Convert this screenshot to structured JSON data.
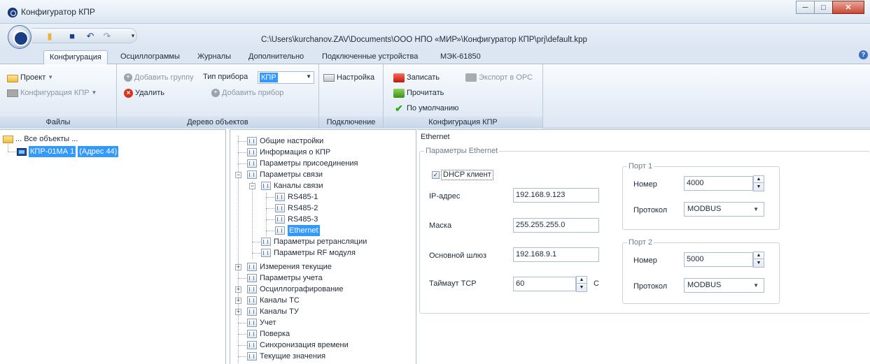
{
  "window": {
    "title": "Конфигуратор КПР",
    "file_path": "C:\\Users\\kurchanov.ZAV\\Documents\\ООО НПО «МИР»\\Конфигуратор КПР\\prj\\default.kpp"
  },
  "tabs": [
    {
      "label": "Конфигурация"
    },
    {
      "label": "Осциллограммы"
    },
    {
      "label": "Журналы"
    },
    {
      "label": "Дополнительно"
    },
    {
      "label": "Подключенные устройства"
    },
    {
      "label": "МЭК-61850"
    }
  ],
  "ribbon": {
    "files": {
      "label": "Файлы",
      "project": "Проект",
      "config": "Конфигурация КПР"
    },
    "tree": {
      "label": "Дерево объектов",
      "add_group": "Добавить группу",
      "device_type_label": "Тип прибора",
      "device_type_value": "КПР",
      "delete": "Удалить",
      "add_device": "Добавить прибор"
    },
    "connection": {
      "label": "Подключение",
      "settings": "Настройка"
    },
    "kpr_config": {
      "label": "Конфигурация КПР",
      "write": "Записать",
      "export_opc": "Экспорт в OPC",
      "read": "Прочитать",
      "defaults": "По умолчанию"
    }
  },
  "objects_tree": {
    "root": "... Все объекты ...",
    "device_name": "КПР-01МА 1",
    "device_address": "(Адрес 44)"
  },
  "settings_tree": [
    {
      "label": "Общие настройки"
    },
    {
      "label": "Информация о КПР"
    },
    {
      "label": "Параметры присоединения"
    },
    {
      "label": "Параметры связи"
    },
    {
      "label": "Каналы связи"
    },
    {
      "label": "RS485-1"
    },
    {
      "label": "RS485-2"
    },
    {
      "label": "RS485-3"
    },
    {
      "label": "Ethernet"
    },
    {
      "label": "Параметры ретрансляции"
    },
    {
      "label": "Параметры RF модуля"
    },
    {
      "label": "Измерения текущие"
    },
    {
      "label": "Параметры учета"
    },
    {
      "label": "Осциллографирование"
    },
    {
      "label": "Каналы ТС"
    },
    {
      "label": "Каналы ТУ"
    },
    {
      "label": "Учет"
    },
    {
      "label": "Поверка"
    },
    {
      "label": "Синхронизация времени"
    },
    {
      "label": "Текущие значения"
    }
  ],
  "ethernet": {
    "section_title": "Ethernet",
    "group_title": "Параметры Ethernet",
    "dhcp_label": "DHCP клиент",
    "dhcp_checked": true,
    "ip_label": "IP-адрес",
    "ip_value": "192.168.9.123",
    "mask_label": "Маска",
    "mask_value": "255.255.255.0",
    "gateway_label": "Основной шлюз",
    "gateway_value": "192.168.9.1",
    "timeout_label": "Таймаут TCP",
    "timeout_value": "60",
    "timeout_unit": "С",
    "port1": {
      "title": "Порт 1",
      "number_label": "Номер",
      "number_value": "4000",
      "protocol_label": "Протокол",
      "protocol_value": "MODBUS"
    },
    "port2": {
      "title": "Порт 2",
      "number_label": "Номер",
      "number_value": "5000",
      "protocol_label": "Протокол",
      "protocol_value": "MODBUS"
    }
  }
}
